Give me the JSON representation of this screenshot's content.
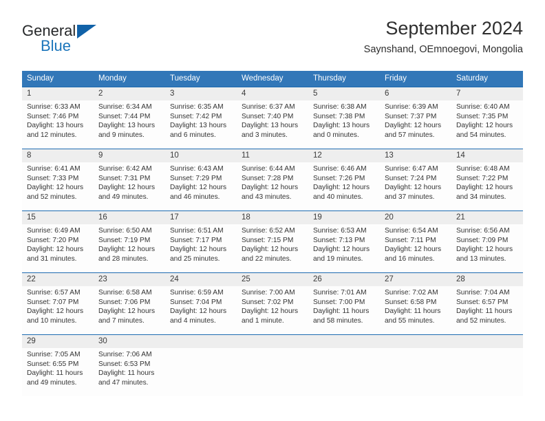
{
  "logo": {
    "text_top": "General",
    "text_bottom": "Blue",
    "triangle_color": "#1162a8",
    "blue_color": "#1b75bb"
  },
  "header": {
    "title": "September 2024",
    "subtitle": "Saynshand, OEmnoegovi, Mongolia"
  },
  "theme": {
    "header_blue": "#3277b8",
    "row_divider_blue": "#1c6ab0",
    "day_band_gray": "#eeeeee"
  },
  "weekdays": [
    "Sunday",
    "Monday",
    "Tuesday",
    "Wednesday",
    "Thursday",
    "Friday",
    "Saturday"
  ],
  "weeks": [
    [
      {
        "day": "1",
        "sunrise": "Sunrise: 6:33 AM",
        "sunset": "Sunset: 7:46 PM",
        "daylight_1": "Daylight: 13 hours",
        "daylight_2": "and 12 minutes."
      },
      {
        "day": "2",
        "sunrise": "Sunrise: 6:34 AM",
        "sunset": "Sunset: 7:44 PM",
        "daylight_1": "Daylight: 13 hours",
        "daylight_2": "and 9 minutes."
      },
      {
        "day": "3",
        "sunrise": "Sunrise: 6:35 AM",
        "sunset": "Sunset: 7:42 PM",
        "daylight_1": "Daylight: 13 hours",
        "daylight_2": "and 6 minutes."
      },
      {
        "day": "4",
        "sunrise": "Sunrise: 6:37 AM",
        "sunset": "Sunset: 7:40 PM",
        "daylight_1": "Daylight: 13 hours",
        "daylight_2": "and 3 minutes."
      },
      {
        "day": "5",
        "sunrise": "Sunrise: 6:38 AM",
        "sunset": "Sunset: 7:38 PM",
        "daylight_1": "Daylight: 13 hours",
        "daylight_2": "and 0 minutes."
      },
      {
        "day": "6",
        "sunrise": "Sunrise: 6:39 AM",
        "sunset": "Sunset: 7:37 PM",
        "daylight_1": "Daylight: 12 hours",
        "daylight_2": "and 57 minutes."
      },
      {
        "day": "7",
        "sunrise": "Sunrise: 6:40 AM",
        "sunset": "Sunset: 7:35 PM",
        "daylight_1": "Daylight: 12 hours",
        "daylight_2": "and 54 minutes."
      }
    ],
    [
      {
        "day": "8",
        "sunrise": "Sunrise: 6:41 AM",
        "sunset": "Sunset: 7:33 PM",
        "daylight_1": "Daylight: 12 hours",
        "daylight_2": "and 52 minutes."
      },
      {
        "day": "9",
        "sunrise": "Sunrise: 6:42 AM",
        "sunset": "Sunset: 7:31 PM",
        "daylight_1": "Daylight: 12 hours",
        "daylight_2": "and 49 minutes."
      },
      {
        "day": "10",
        "sunrise": "Sunrise: 6:43 AM",
        "sunset": "Sunset: 7:29 PM",
        "daylight_1": "Daylight: 12 hours",
        "daylight_2": "and 46 minutes."
      },
      {
        "day": "11",
        "sunrise": "Sunrise: 6:44 AM",
        "sunset": "Sunset: 7:28 PM",
        "daylight_1": "Daylight: 12 hours",
        "daylight_2": "and 43 minutes."
      },
      {
        "day": "12",
        "sunrise": "Sunrise: 6:46 AM",
        "sunset": "Sunset: 7:26 PM",
        "daylight_1": "Daylight: 12 hours",
        "daylight_2": "and 40 minutes."
      },
      {
        "day": "13",
        "sunrise": "Sunrise: 6:47 AM",
        "sunset": "Sunset: 7:24 PM",
        "daylight_1": "Daylight: 12 hours",
        "daylight_2": "and 37 minutes."
      },
      {
        "day": "14",
        "sunrise": "Sunrise: 6:48 AM",
        "sunset": "Sunset: 7:22 PM",
        "daylight_1": "Daylight: 12 hours",
        "daylight_2": "and 34 minutes."
      }
    ],
    [
      {
        "day": "15",
        "sunrise": "Sunrise: 6:49 AM",
        "sunset": "Sunset: 7:20 PM",
        "daylight_1": "Daylight: 12 hours",
        "daylight_2": "and 31 minutes."
      },
      {
        "day": "16",
        "sunrise": "Sunrise: 6:50 AM",
        "sunset": "Sunset: 7:19 PM",
        "daylight_1": "Daylight: 12 hours",
        "daylight_2": "and 28 minutes."
      },
      {
        "day": "17",
        "sunrise": "Sunrise: 6:51 AM",
        "sunset": "Sunset: 7:17 PM",
        "daylight_1": "Daylight: 12 hours",
        "daylight_2": "and 25 minutes."
      },
      {
        "day": "18",
        "sunrise": "Sunrise: 6:52 AM",
        "sunset": "Sunset: 7:15 PM",
        "daylight_1": "Daylight: 12 hours",
        "daylight_2": "and 22 minutes."
      },
      {
        "day": "19",
        "sunrise": "Sunrise: 6:53 AM",
        "sunset": "Sunset: 7:13 PM",
        "daylight_1": "Daylight: 12 hours",
        "daylight_2": "and 19 minutes."
      },
      {
        "day": "20",
        "sunrise": "Sunrise: 6:54 AM",
        "sunset": "Sunset: 7:11 PM",
        "daylight_1": "Daylight: 12 hours",
        "daylight_2": "and 16 minutes."
      },
      {
        "day": "21",
        "sunrise": "Sunrise: 6:56 AM",
        "sunset": "Sunset: 7:09 PM",
        "daylight_1": "Daylight: 12 hours",
        "daylight_2": "and 13 minutes."
      }
    ],
    [
      {
        "day": "22",
        "sunrise": "Sunrise: 6:57 AM",
        "sunset": "Sunset: 7:07 PM",
        "daylight_1": "Daylight: 12 hours",
        "daylight_2": "and 10 minutes."
      },
      {
        "day": "23",
        "sunrise": "Sunrise: 6:58 AM",
        "sunset": "Sunset: 7:06 PM",
        "daylight_1": "Daylight: 12 hours",
        "daylight_2": "and 7 minutes."
      },
      {
        "day": "24",
        "sunrise": "Sunrise: 6:59 AM",
        "sunset": "Sunset: 7:04 PM",
        "daylight_1": "Daylight: 12 hours",
        "daylight_2": "and 4 minutes."
      },
      {
        "day": "25",
        "sunrise": "Sunrise: 7:00 AM",
        "sunset": "Sunset: 7:02 PM",
        "daylight_1": "Daylight: 12 hours",
        "daylight_2": "and 1 minute."
      },
      {
        "day": "26",
        "sunrise": "Sunrise: 7:01 AM",
        "sunset": "Sunset: 7:00 PM",
        "daylight_1": "Daylight: 11 hours",
        "daylight_2": "and 58 minutes."
      },
      {
        "day": "27",
        "sunrise": "Sunrise: 7:02 AM",
        "sunset": "Sunset: 6:58 PM",
        "daylight_1": "Daylight: 11 hours",
        "daylight_2": "and 55 minutes."
      },
      {
        "day": "28",
        "sunrise": "Sunrise: 7:04 AM",
        "sunset": "Sunset: 6:57 PM",
        "daylight_1": "Daylight: 11 hours",
        "daylight_2": "and 52 minutes."
      }
    ],
    [
      {
        "day": "29",
        "sunrise": "Sunrise: 7:05 AM",
        "sunset": "Sunset: 6:55 PM",
        "daylight_1": "Daylight: 11 hours",
        "daylight_2": "and 49 minutes."
      },
      {
        "day": "30",
        "sunrise": "Sunrise: 7:06 AM",
        "sunset": "Sunset: 6:53 PM",
        "daylight_1": "Daylight: 11 hours",
        "daylight_2": "and 47 minutes."
      },
      {
        "day": "",
        "sunrise": "",
        "sunset": "",
        "daylight_1": "",
        "daylight_2": ""
      },
      {
        "day": "",
        "sunrise": "",
        "sunset": "",
        "daylight_1": "",
        "daylight_2": ""
      },
      {
        "day": "",
        "sunrise": "",
        "sunset": "",
        "daylight_1": "",
        "daylight_2": ""
      },
      {
        "day": "",
        "sunrise": "",
        "sunset": "",
        "daylight_1": "",
        "daylight_2": ""
      },
      {
        "day": "",
        "sunrise": "",
        "sunset": "",
        "daylight_1": "",
        "daylight_2": ""
      }
    ]
  ]
}
